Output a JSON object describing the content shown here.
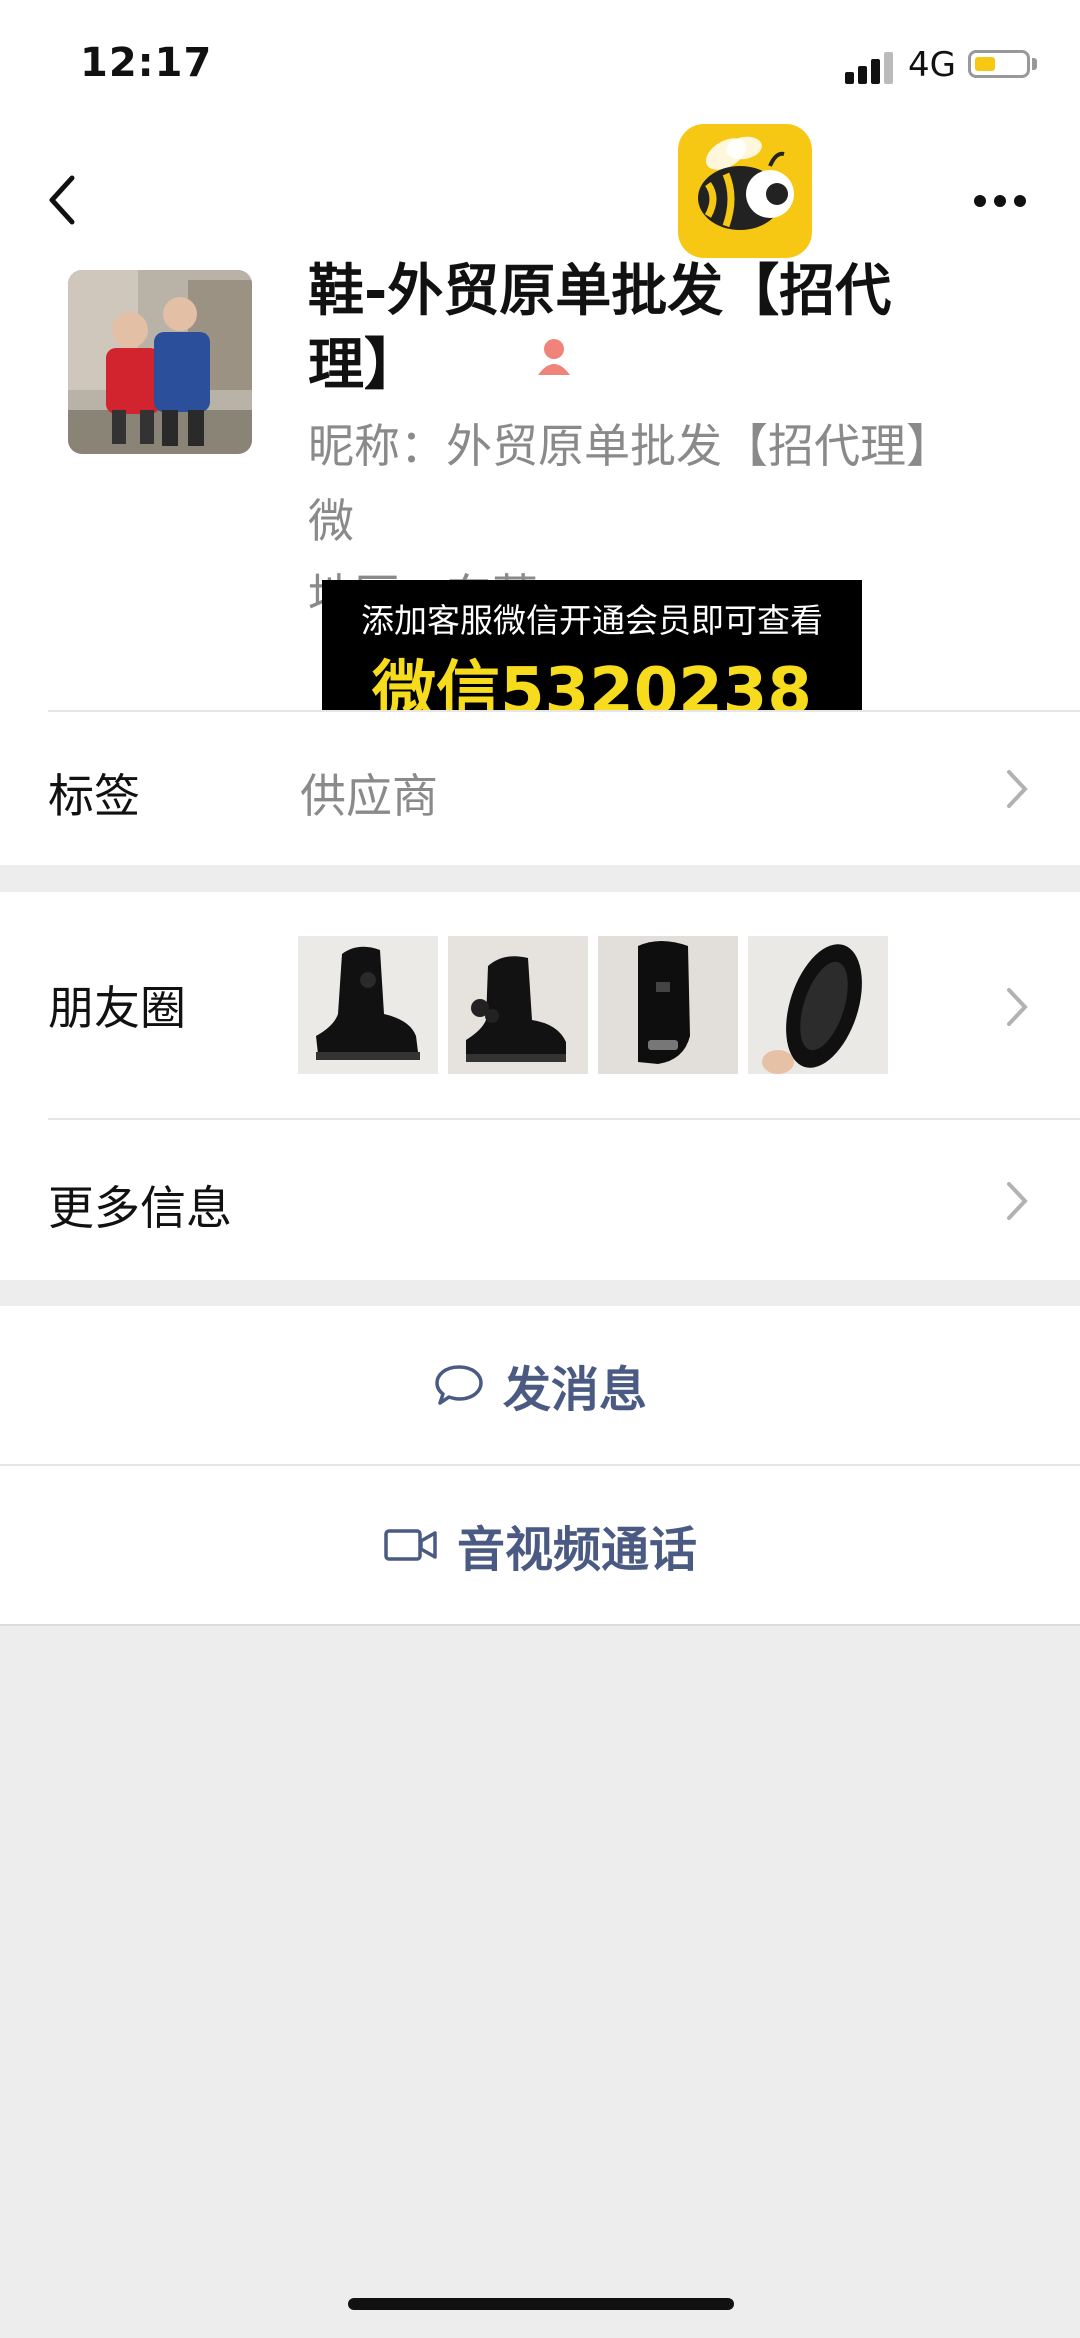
{
  "status_bar": {
    "time": "12:17",
    "network": "4G"
  },
  "profile": {
    "name": "鞋-外贸原单批发【招代理】",
    "nickname": "昵称：外贸原单批发【招代理】",
    "line2_fragment": "微",
    "region_fragment": "地区：东莞"
  },
  "watermark": {
    "line1": "添加客服微信开通会员即可查看",
    "line2": "微信5320238"
  },
  "rows": {
    "tags_label": "标签",
    "tags_value": "供应商",
    "moments_label": "朋友圈",
    "more_info_label": "更多信息"
  },
  "actions": {
    "message_label": "发消息",
    "call_label": "音视频通话"
  },
  "colors": {
    "accent_blue": "#4a5a82",
    "watermark_yellow": "#f6dc1c",
    "logo_yellow": "#f6c814",
    "page_gray": "#ededed"
  }
}
